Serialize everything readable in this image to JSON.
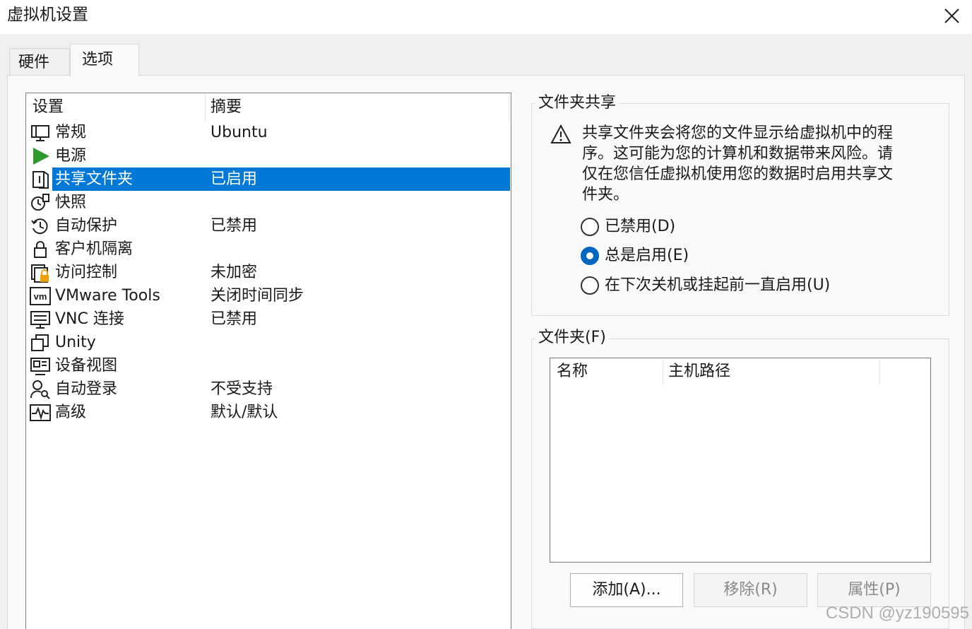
{
  "window": {
    "title": "虚拟机设置"
  },
  "tabs": [
    {
      "label": "硬件",
      "active": false
    },
    {
      "label": "选项",
      "active": true
    }
  ],
  "settings_list": {
    "columns": [
      "设置",
      "摘要"
    ],
    "items": [
      {
        "label": "常规",
        "summary": "Ubuntu",
        "icon": "monitor-icon"
      },
      {
        "label": "电源",
        "summary": "",
        "icon": "power-play-icon"
      },
      {
        "label": "共享文件夹",
        "summary": "已启用",
        "icon": "shared-folder-icon",
        "selected": true
      },
      {
        "label": "快照",
        "summary": "",
        "icon": "snapshot-icon"
      },
      {
        "label": "自动保护",
        "summary": "已禁用",
        "icon": "clock-icon"
      },
      {
        "label": "客户机隔离",
        "summary": "",
        "icon": "lock-icon"
      },
      {
        "label": "访问控制",
        "summary": "未加密",
        "icon": "access-lock-icon"
      },
      {
        "label": "VMware Tools",
        "summary": "关闭时间同步",
        "icon": "vm-icon"
      },
      {
        "label": "VNC 连接",
        "summary": "已禁用",
        "icon": "vnc-icon"
      },
      {
        "label": "Unity",
        "summary": "",
        "icon": "unity-icon"
      },
      {
        "label": "设备视图",
        "summary": "",
        "icon": "device-view-icon"
      },
      {
        "label": "自动登录",
        "summary": "不受支持",
        "icon": "user-key-icon"
      },
      {
        "label": "高级",
        "summary": "默认/默认",
        "icon": "pulse-icon"
      }
    ]
  },
  "folder_sharing": {
    "title": "文件夹共享",
    "warning": "共享文件夹会将您的文件显示给虚拟机中的程序。这可能为您的计算机和数据带来风险。请仅在您信任虚拟机使用您的数据时启用共享文件夹。",
    "options": [
      {
        "label": "已禁用(D)",
        "checked": false
      },
      {
        "label": "总是启用(E)",
        "checked": true
      },
      {
        "label": "在下次关机或挂起前一直启用(U)",
        "checked": false
      }
    ]
  },
  "folders": {
    "title": "文件夹(F)",
    "columns": [
      "名称",
      "主机路径"
    ],
    "rows": []
  },
  "buttons": {
    "add": "添加(A)...",
    "remove": "移除(R)",
    "properties": "属性(P)"
  },
  "watermark": "CSDN @yz190595",
  "colors": {
    "selection": "#0078d7",
    "power_green": "#2c9a2c",
    "access_orange": "#f0a000"
  }
}
